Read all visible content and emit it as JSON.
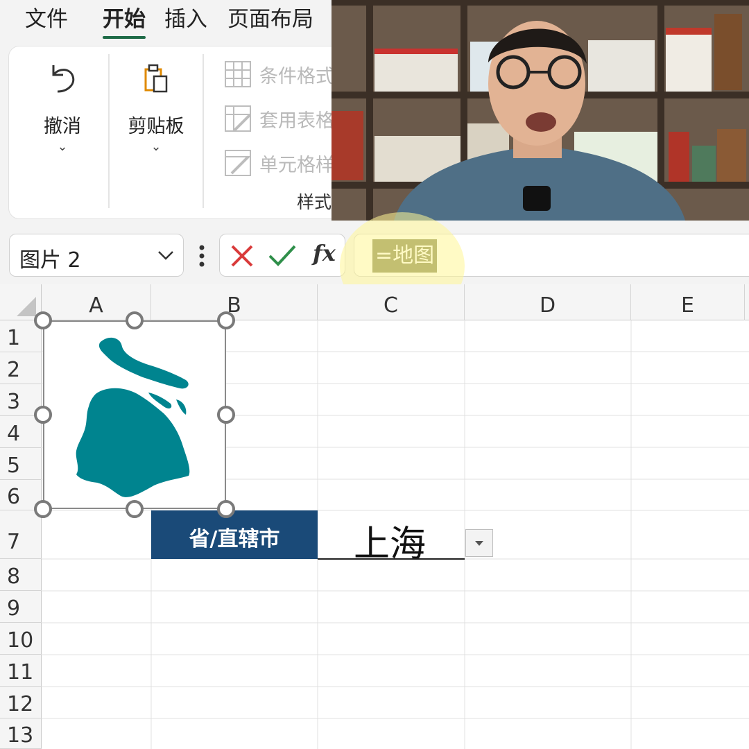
{
  "ribbon": {
    "tabs": [
      {
        "label": "文件"
      },
      {
        "label": "开始",
        "active": true
      },
      {
        "label": "插入"
      },
      {
        "label": "页面布局"
      }
    ],
    "undo": {
      "label": "撤消",
      "icon": "undo-icon"
    },
    "clipboard": {
      "label": "剪贴板",
      "icon": "clipboard-icon"
    },
    "styles": {
      "group_label": "样式",
      "items": [
        {
          "label": "条件格式",
          "icon": "conditional-format-icon"
        },
        {
          "label": "套用表格格式",
          "icon": "table-format-icon"
        },
        {
          "label": "单元格样式",
          "icon": "cell-style-icon"
        }
      ]
    }
  },
  "formula_bar": {
    "name_box": "图片 2",
    "cancel_icon": "cancel-icon",
    "confirm_icon": "confirm-icon",
    "fx_label": "fx",
    "formula": "=地图"
  },
  "grid": {
    "columns": [
      "A",
      "B",
      "C",
      "D",
      "E"
    ],
    "rows": [
      "1",
      "2",
      "3",
      "4",
      "5",
      "6",
      "7",
      "8",
      "9",
      "10",
      "11",
      "12",
      "13"
    ]
  },
  "cells": {
    "B7": "省/直辖市",
    "C7": "上海"
  },
  "picture": {
    "icon": "shanghai-map-icon",
    "color": "#00848f"
  },
  "colors": {
    "accent": "#1e6b47",
    "header_cell": "#1a4a78",
    "cancel": "#d93b3b",
    "confirm": "#2f8f4a"
  }
}
